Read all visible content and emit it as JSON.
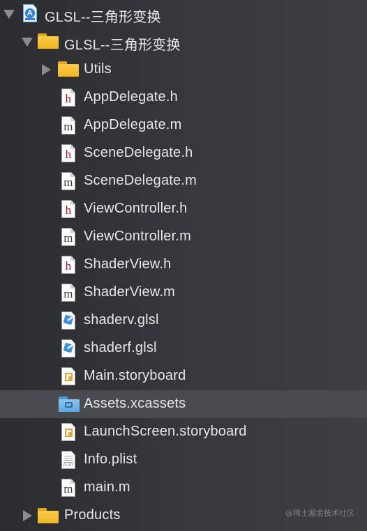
{
  "navigator": {
    "project": {
      "name": "GLSL--三角形变换",
      "expanded": true
    },
    "group": {
      "name": "GLSL--三角形变换",
      "expanded": true
    },
    "utils": {
      "name": "Utils",
      "expanded": false
    },
    "files": [
      {
        "name": "AppDelegate.h",
        "type": "h"
      },
      {
        "name": "AppDelegate.m",
        "type": "m"
      },
      {
        "name": "SceneDelegate.h",
        "type": "h"
      },
      {
        "name": "SceneDelegate.m",
        "type": "m"
      },
      {
        "name": "ViewController.h",
        "type": "h"
      },
      {
        "name": "ViewController.m",
        "type": "m"
      },
      {
        "name": "ShaderView.h",
        "type": "h"
      },
      {
        "name": "ShaderView.m",
        "type": "m"
      },
      {
        "name": "shaderv.glsl",
        "type": "glsl"
      },
      {
        "name": "shaderf.glsl",
        "type": "glsl"
      },
      {
        "name": "Main.storyboard",
        "type": "storyboard"
      },
      {
        "name": "Assets.xcassets",
        "type": "xcassets",
        "selected": true
      },
      {
        "name": "LaunchScreen.storyboard",
        "type": "storyboard"
      },
      {
        "name": "Info.plist",
        "type": "plist"
      },
      {
        "name": "main.m",
        "type": "m"
      }
    ],
    "products": {
      "name": "Products",
      "expanded": false
    },
    "icons": {
      "h_glyph": "h",
      "m_glyph": "m",
      "plist_caption": "PLIST",
      "project_glyph": "A"
    }
  },
  "watermark": "@稀土掘金技术社区"
}
